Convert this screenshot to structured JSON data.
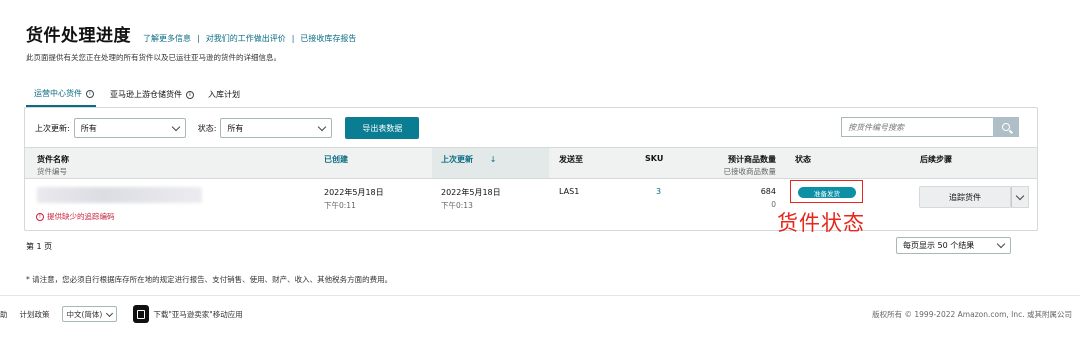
{
  "header": {
    "title": "货件处理进度",
    "links": [
      "了解更多信息",
      "对我们的工作做出评价",
      "已接收库存报告"
    ],
    "description": "此页面提供有关您正在处理的所有货件以及已运往亚马逊的货件的详细信息。"
  },
  "tabs": [
    {
      "label": "运营中心货件",
      "active": true
    },
    {
      "label": "亚马逊上游仓储货件",
      "active": false
    },
    {
      "label": "入库计划",
      "active": false
    }
  ],
  "filters": {
    "last_updated_label": "上次更新:",
    "last_updated_value": "所有",
    "status_label": "状态:",
    "status_value": "所有",
    "export_label": "导出表数据",
    "search_placeholder": "按货件编号搜索"
  },
  "table": {
    "columns": [
      {
        "label": "货件名称",
        "sub": "货件编号"
      },
      {
        "label": "已创建",
        "sub": ""
      },
      {
        "label": "上次更新",
        "sub": ""
      },
      {
        "label": "发送至",
        "sub": ""
      },
      {
        "label": "SKU",
        "sub": ""
      },
      {
        "label": "预计商品数量",
        "sub": "已接收商品数量"
      },
      {
        "label": "状态",
        "sub": ""
      },
      {
        "label": "后续步骤",
        "sub": ""
      }
    ],
    "sort_arrow": "↓",
    "rows": [
      {
        "warning": "提供缺少的追踪编码",
        "created_date": "2022年5月18日",
        "created_time": "下午0:11",
        "updated_date": "2022年5月18日",
        "updated_time": "下午0:13",
        "destination": "LAS1",
        "sku": "3",
        "expected": "684",
        "received": "0",
        "status": "准备发货",
        "next_step": "追踪货件"
      }
    ]
  },
  "annotation": "货件状态",
  "pagination": {
    "page": "第 1 页",
    "per_page": "每页显示 50 个结果"
  },
  "footnote": "* 请注意，您必须自行根据库存所在地的规定进行报告、支付销售、使用、财产、收入、其他税务方面的费用。",
  "footer": {
    "left_cut": "助",
    "policy": "计划政策",
    "language": "中文(简体)",
    "app_text": "下载\"亚马逊卖家\"移动应用",
    "copyright": "版权所有 © 1999-2022 Amazon.com, Inc. 或其附属公司"
  },
  "colors": {
    "accent": "#0a6c83",
    "button": "#0b7d92",
    "status_pill": "#0d8fa6",
    "annotation_red": "#e8261d",
    "warning_red": "#c7243a"
  }
}
